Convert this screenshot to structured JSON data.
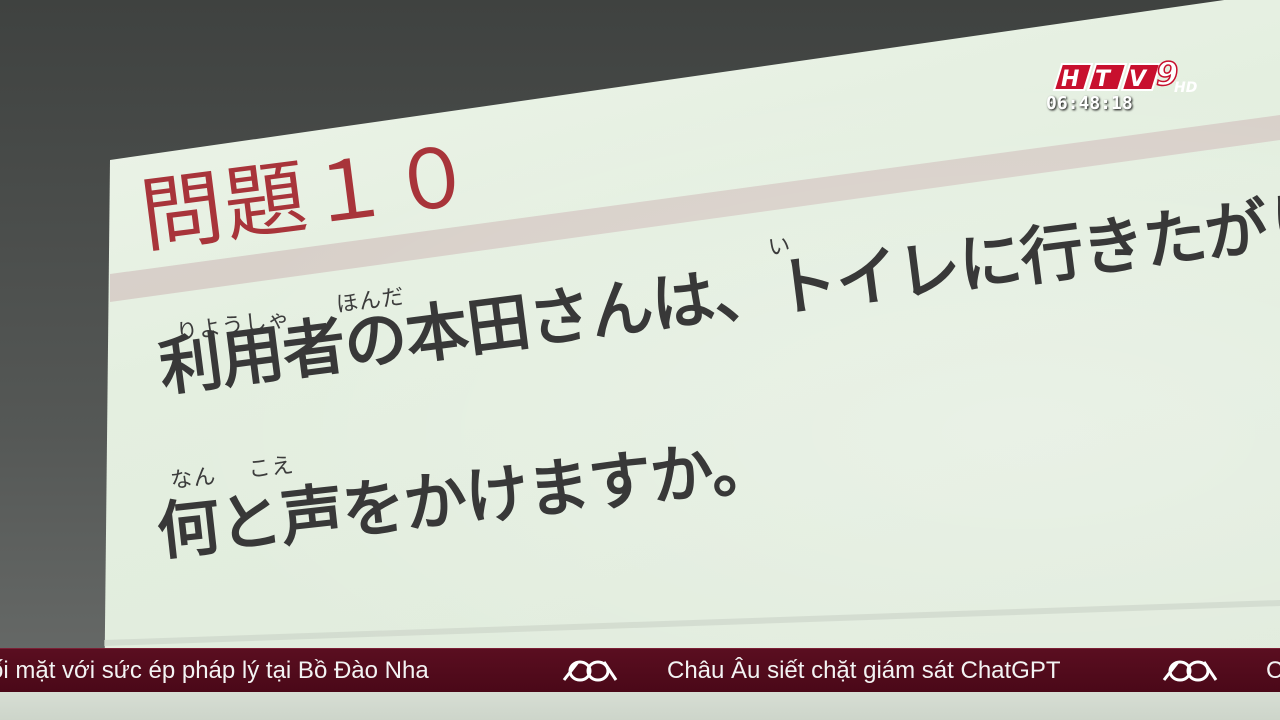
{
  "slide": {
    "title": "問題１０",
    "line1": "利用者の本田さんは、トイレに行きたがりません。",
    "line2": "何と声をかけますか。",
    "ruby": {
      "riyousha": "りようしゃ",
      "honda": "ほんだ",
      "i": "い",
      "nan": "なん",
      "koe": "こえ"
    }
  },
  "overlay": {
    "channel_logo": "HTV9",
    "logo_hd": "HD",
    "clock": "06:48:18"
  },
  "ticker": {
    "items": [
      "ối mặt với sức ép pháp lý tại Bồ Đào Nha",
      "Châu Âu siết chặt giám sát ChatGPT",
      "C"
    ],
    "separator_icon": "htv-logo-icon",
    "colors": {
      "background": "#4a0818",
      "text": "#f3f3f3"
    }
  }
}
